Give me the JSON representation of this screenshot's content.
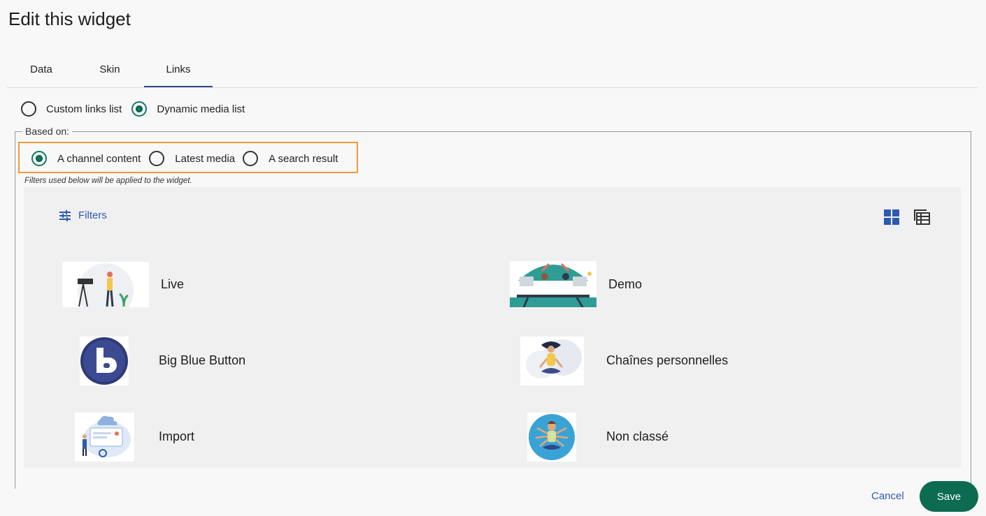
{
  "dialog": {
    "title": "Edit this widget"
  },
  "tabs": [
    {
      "label": "Data",
      "active": false
    },
    {
      "label": "Skin",
      "active": false
    },
    {
      "label": "Links",
      "active": true
    }
  ],
  "link_mode": {
    "options": [
      {
        "label": "Custom links list",
        "checked": false
      },
      {
        "label": "Dynamic media list",
        "checked": true
      }
    ]
  },
  "based_on": {
    "legend": "Based on:",
    "options": [
      {
        "label": "A channel content",
        "checked": true
      },
      {
        "label": "Latest media",
        "checked": false
      },
      {
        "label": "A search result",
        "checked": false
      }
    ],
    "note": "Filters used below will be applied to the widget."
  },
  "toolbar": {
    "filters_label": "Filters",
    "icons": [
      "tune-icon",
      "grid-view-icon",
      "list-view-icon"
    ]
  },
  "channels": [
    {
      "name": "Live",
      "icon": "live-illustration"
    },
    {
      "name": "Demo",
      "icon": "demo-illustration"
    },
    {
      "name": "Big Blue Button",
      "icon": "bigbluebutton-logo"
    },
    {
      "name": "Chaînes personnelles",
      "icon": "meditation-illustration"
    },
    {
      "name": "Import",
      "icon": "import-illustration"
    },
    {
      "name": "Non classé",
      "icon": "multitask-illustration"
    }
  ],
  "footer": {
    "cancel_label": "Cancel",
    "save_label": "Save"
  },
  "colors": {
    "accent": "#0d7a62",
    "link": "#2d5ab0",
    "highlight": "#f29a38",
    "save": "#0d6b52"
  }
}
